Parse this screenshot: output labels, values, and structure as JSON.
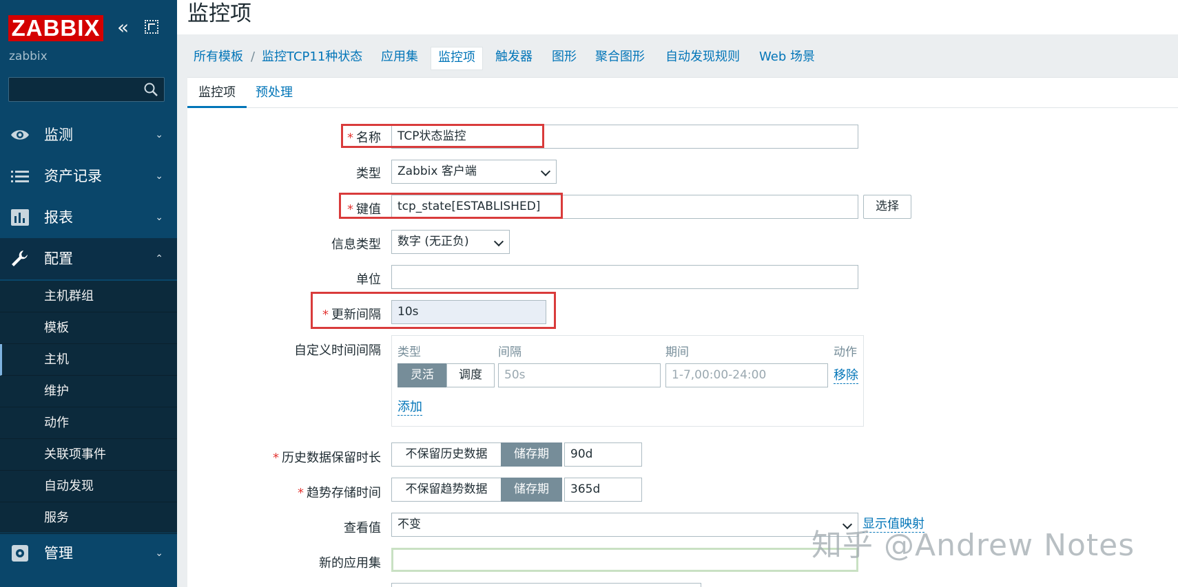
{
  "sidebar": {
    "logo": "ZABBIX",
    "collapse_glyph": "«",
    "server_name": "zabbix",
    "search_placeholder": "",
    "menu": [
      {
        "label": "监测",
        "icon": "eye-icon",
        "caret": "⌄"
      },
      {
        "label": "资产记录",
        "icon": "list-icon",
        "caret": "⌄"
      },
      {
        "label": "报表",
        "icon": "bar-chart-icon",
        "caret": "⌄"
      },
      {
        "label": "配置",
        "icon": "wrench-icon",
        "caret": "⌃"
      },
      {
        "label": "管理",
        "icon": "gear-icon",
        "caret": "⌄"
      }
    ],
    "submenu": [
      "主机群组",
      "模板",
      "主机",
      "维护",
      "动作",
      "关联项事件",
      "自动发现",
      "服务"
    ],
    "selected_submenu": "主机"
  },
  "header": {
    "title": "监控项"
  },
  "nav": {
    "breadcrumb_root": "所有模板",
    "separator": "/",
    "breadcrumb_template": "监控TCP11种状态",
    "tabs": [
      "应用集",
      "监控项",
      "触发器",
      "图形",
      "聚合图形",
      "自动发现规则",
      "Web 场景"
    ],
    "current_tab": "监控项"
  },
  "form_tabs": {
    "items": "监控项",
    "preprocessing": "预处理"
  },
  "form": {
    "required_mark": "*",
    "name_label": "名称",
    "name_value": "TCP状态监控",
    "type_label": "类型",
    "type_value": "Zabbix 客户端",
    "key_label": "键值",
    "key_value": "tcp_state[ESTABLISHED]",
    "select_button": "选择",
    "info_type_label": "信息类型",
    "info_type_value": "数字 (无正负)",
    "units_label": "单位",
    "units_value": "",
    "update_interval_label": "更新间隔",
    "update_interval_value": "10s",
    "custom_intervals_label": "自定义时间间隔",
    "custom_intervals": {
      "col_type": "类型",
      "col_interval": "间隔",
      "col_period": "期间",
      "col_action": "动作",
      "flexible": "灵活",
      "scheduling": "调度",
      "interval_placeholder": "50s",
      "period_placeholder": "1-7,00:00-24:00",
      "remove": "移除",
      "add": "添加"
    },
    "history_label": "历史数据保留时长",
    "history_no_keep": "不保留历史数据",
    "history_storage": "储存期",
    "history_value": "90d",
    "trends_label": "趋势存储时间",
    "trends_no_keep": "不保留趋势数据",
    "trends_storage": "储存期",
    "trends_value": "365d",
    "show_value_label": "查看值",
    "show_value_value": "不变",
    "show_value_mappings": "显示值映射",
    "new_app_label": "新的应用集",
    "new_app_value": ""
  },
  "watermark": "知乎 @Andrew Notes",
  "colors": {
    "sidebar": "#0a466a",
    "logo": "#d40000",
    "link": "#0275b8",
    "highlight": "#d93b3b"
  }
}
